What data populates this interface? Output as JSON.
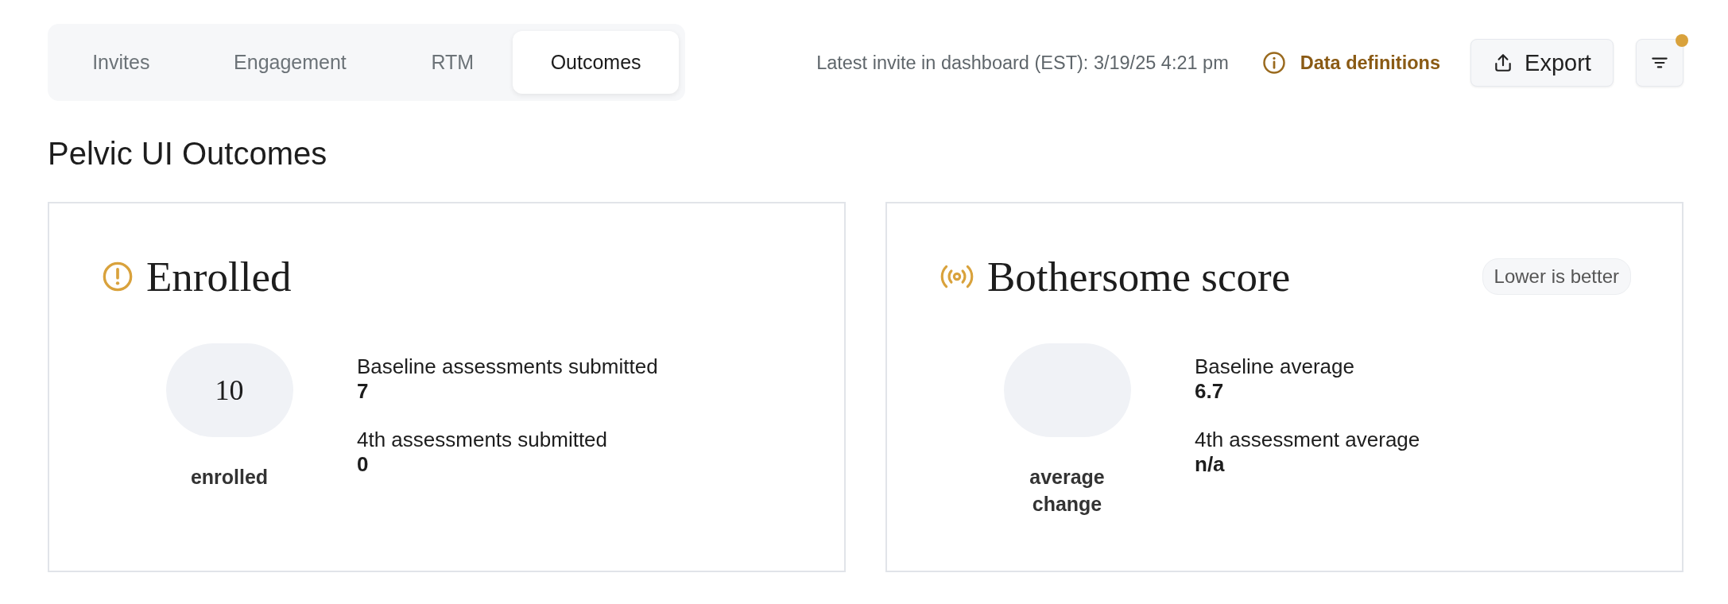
{
  "tabs": [
    {
      "label": "Invites",
      "selected": false
    },
    {
      "label": "Engagement",
      "selected": false
    },
    {
      "label": "RTM",
      "selected": false
    },
    {
      "label": "Outcomes",
      "selected": true
    }
  ],
  "latest_invite": "Latest invite in dashboard (EST): 3/19/25 4:21 pm",
  "data_definitions_link": "Data definitions",
  "export_button": "Export",
  "filter_button": {
    "indicator": true
  },
  "page_title": "Pelvic UI Outcomes",
  "cards": [
    {
      "kind": "alert",
      "title": "Enrolled",
      "value": "10",
      "value_label": "enrolled",
      "stats": [
        {
          "label": "Baseline assessments submitted",
          "value": "7"
        },
        {
          "label": "4th assessments submitted",
          "value": "0"
        }
      ]
    },
    {
      "kind": "signal",
      "title": "Bothersome score",
      "badge": "Lower is better",
      "value_label": "average change",
      "stats": [
        {
          "label": "Baseline average",
          "value": "6.7"
        },
        {
          "label": "4th assessment average",
          "value": "n/a"
        }
      ]
    }
  ]
}
